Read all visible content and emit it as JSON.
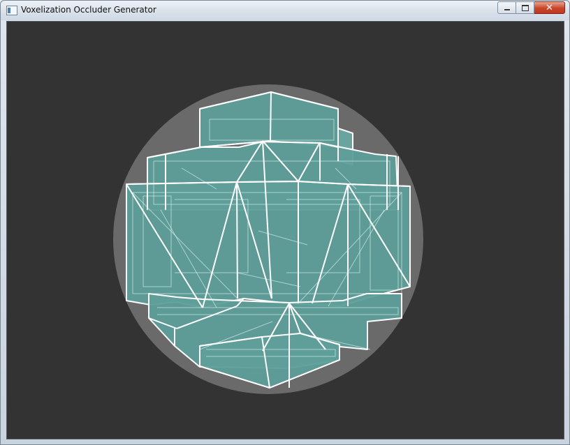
{
  "window": {
    "title": "Voxelization Occluder Generator",
    "icon": "app-icon",
    "controls": {
      "minimize": "minimize-icon",
      "maximize": "maximize-icon",
      "close": "close-icon",
      "close_glyph": "✕"
    }
  },
  "viewport": {
    "background_color": "#333333",
    "sphere_color": "#6a6a6a",
    "occluder_fill": "#5f9e99",
    "wire_color": "#ffffff"
  }
}
